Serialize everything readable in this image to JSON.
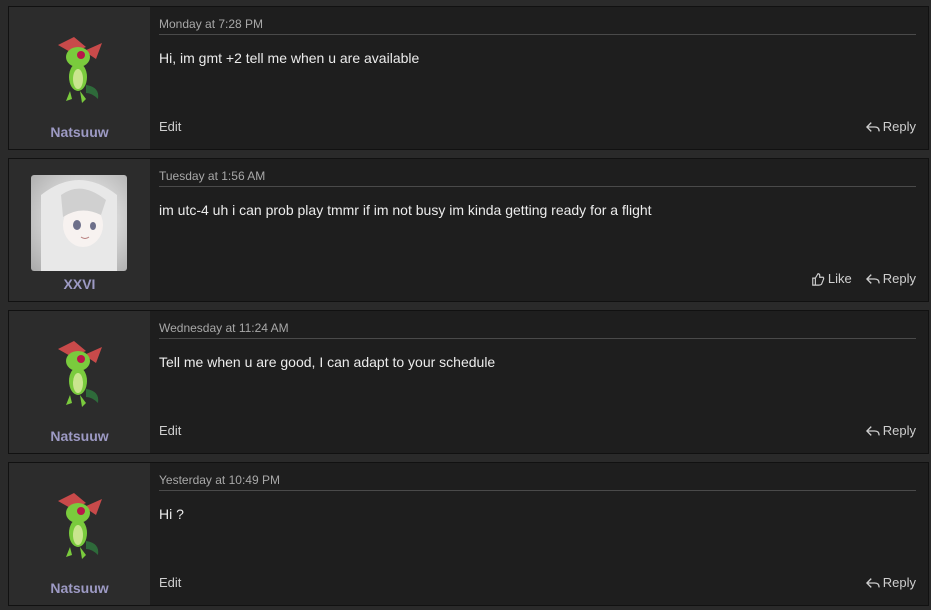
{
  "messages": [
    {
      "user": "Natsuuw",
      "avatar": "green-lizard-sprite",
      "time": "Monday at 7:28 PM",
      "text": "Hi, im gmt +2 tell me when u are available",
      "edit": "Edit",
      "reply": "Reply"
    },
    {
      "user": "XXVI",
      "avatar": "anime-girl-photo",
      "time": "Tuesday at 1:56 AM",
      "text": "im utc-4 uh i can prob play tmmr if im not busy im kinda getting ready for a flight",
      "like": "Like",
      "reply": "Reply"
    },
    {
      "user": "Natsuuw",
      "avatar": "green-lizard-sprite",
      "time": "Wednesday at 11:24 AM",
      "text": "Tell me when u are good, I can adapt to your schedule",
      "edit": "Edit",
      "reply": "Reply"
    },
    {
      "user": "Natsuuw",
      "avatar": "green-lizard-sprite",
      "time": "Yesterday at 10:49 PM",
      "text": "Hi ?",
      "edit": "Edit",
      "reply": "Reply"
    }
  ],
  "icons": {
    "reply": "reply-icon",
    "like": "thumbs-up-icon"
  },
  "colors": {
    "username": "#9d9ac4",
    "card": "#1e1e1e",
    "user_cell": "#2c2c2c",
    "background": "#2a2a2a"
  }
}
